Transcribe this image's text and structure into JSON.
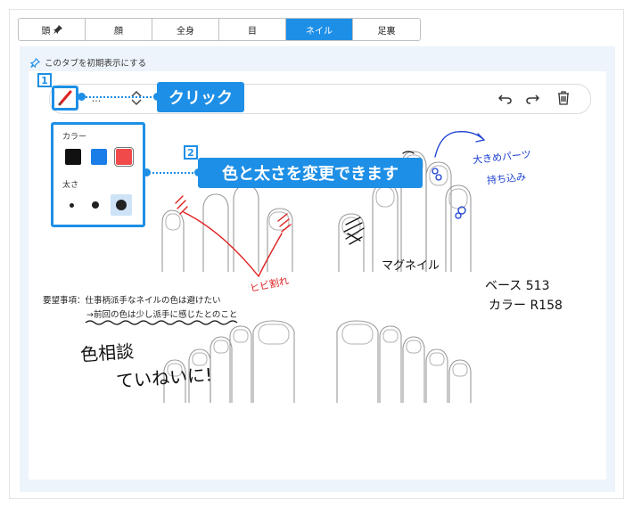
{
  "tabs": [
    {
      "label": "頭"
    },
    {
      "label": "顔"
    },
    {
      "label": "全身"
    },
    {
      "label": "目"
    },
    {
      "label": "ネイル"
    },
    {
      "label": "足裏"
    }
  ],
  "active_tab": "ネイル",
  "default_tab_label": "このタブを初期表示にする",
  "toolbar": {
    "select_value": "..."
  },
  "callouts": {
    "step1_number": "1",
    "step1_text": "クリック",
    "step2_number": "2",
    "step2_text": "色と太さを変更できます"
  },
  "color_panel": {
    "color_label": "カラー",
    "size_label": "太さ",
    "colors": [
      "#111111",
      "#1a7de8",
      "#f04a4a"
    ],
    "selected_color": "#f04a4a"
  },
  "annotations": {
    "hibi": "ヒビ割れ",
    "magnail": "マグネイル",
    "ookime1": "大きめパーツ",
    "ookime2": "持ち込み",
    "base": "ベース 513",
    "color": "カラー R158",
    "request": "要望事項：仕事柄派手なネイルの色は避けたい",
    "request2": "→前回の色は少し派手に感じたとのこと",
    "sodan1": "色相談",
    "sodan2": "ていねいに!"
  },
  "colors": {
    "accent": "#1e8fe6",
    "red_ink": "#e02020",
    "blue_ink": "#1a3fd0"
  }
}
